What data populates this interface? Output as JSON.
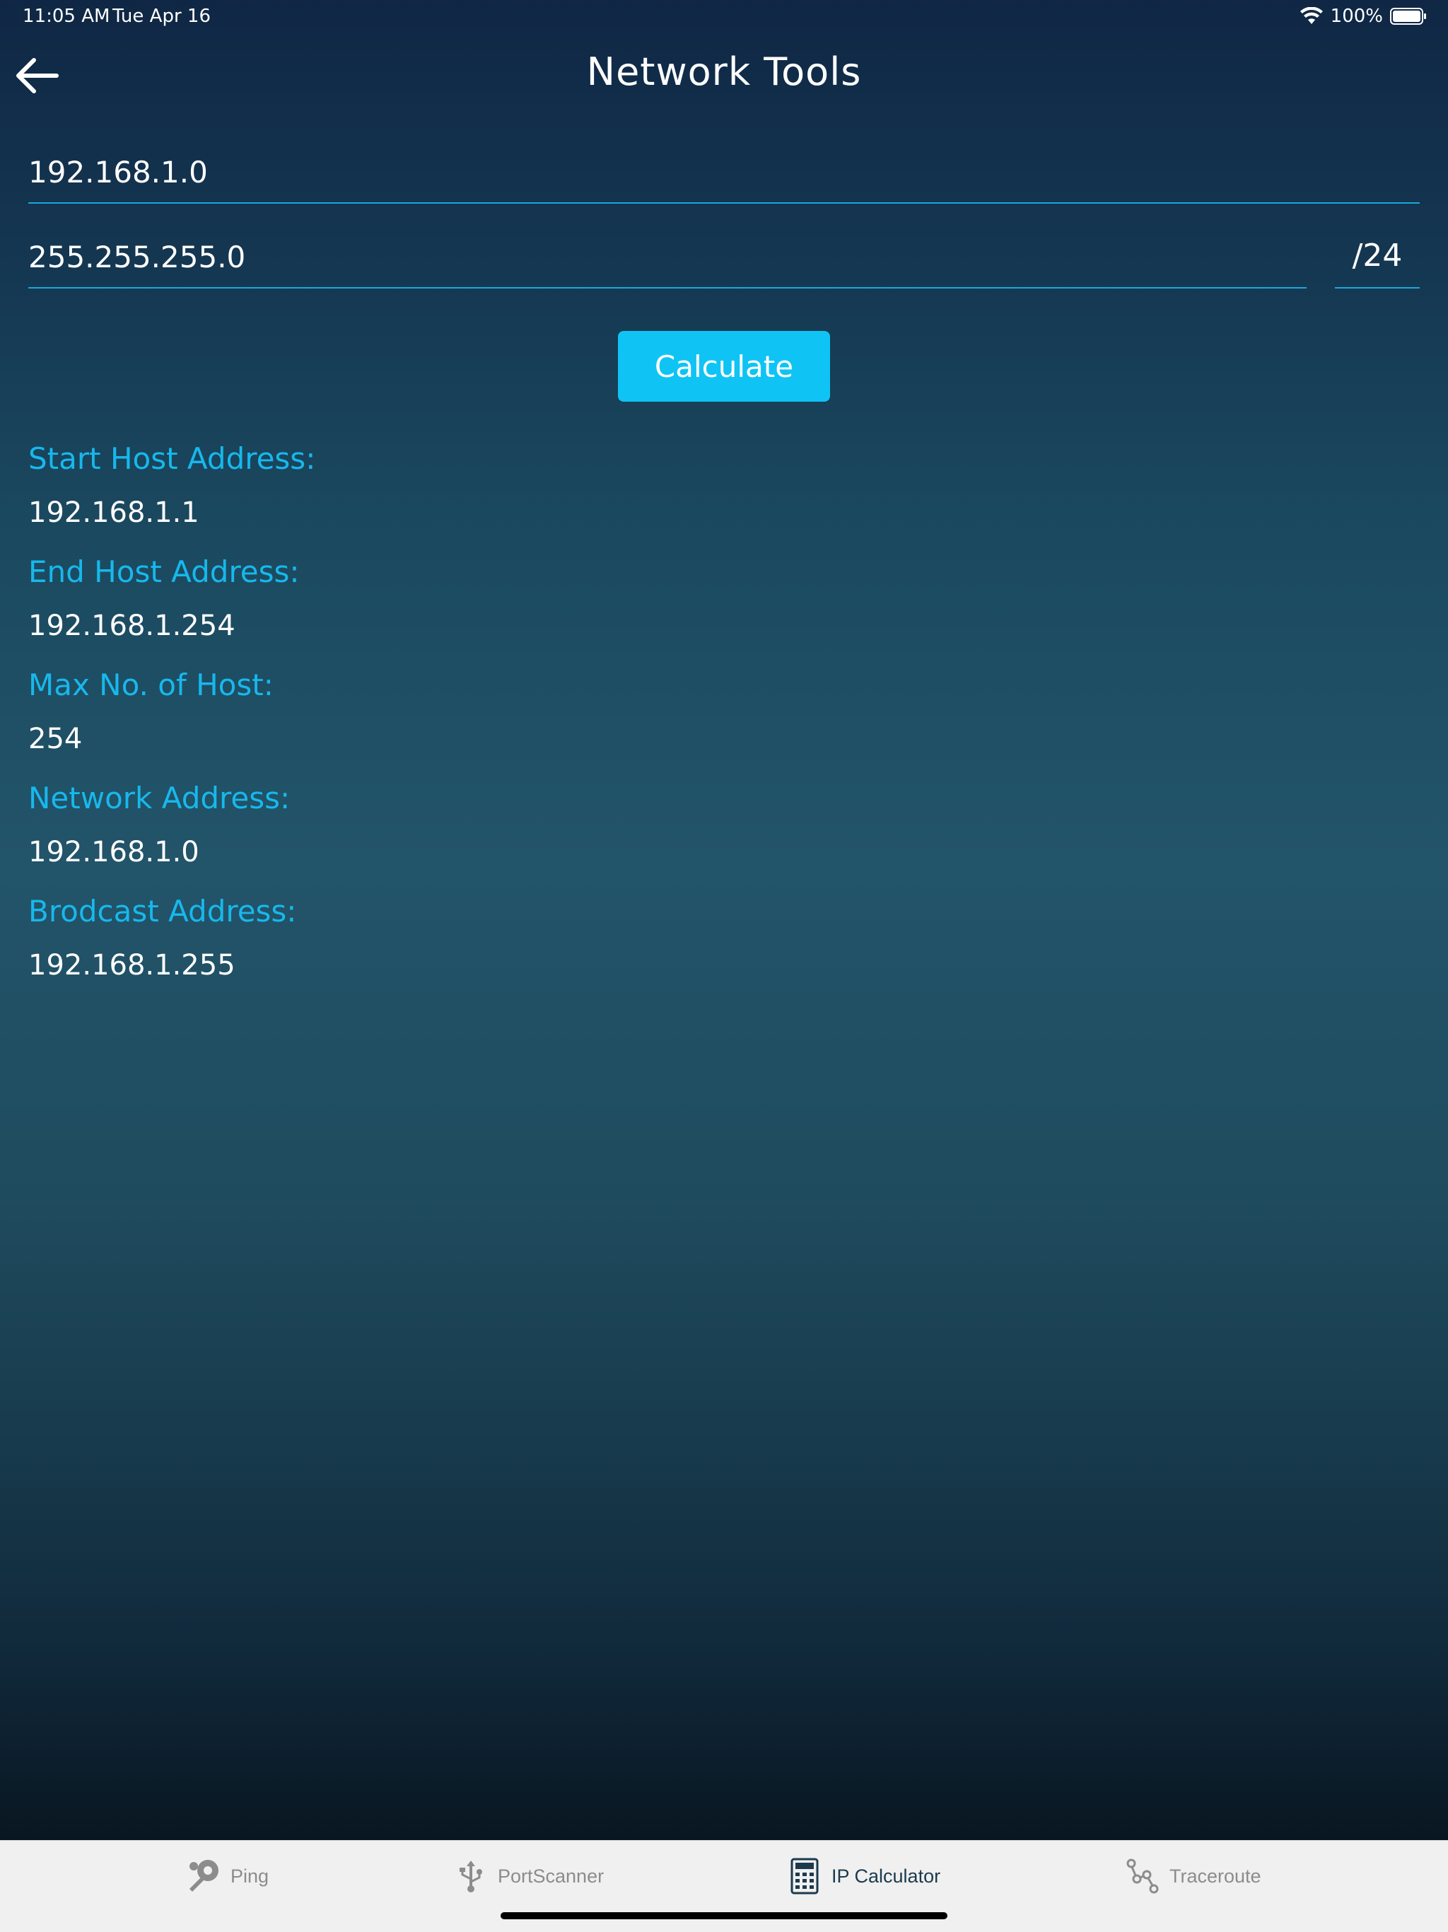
{
  "status_bar": {
    "time": "11:05 AM",
    "date": "Tue Apr 16",
    "battery": "100%"
  },
  "header": {
    "title": "Network Tools"
  },
  "form": {
    "ip_value": "192.168.1.0",
    "mask_value": "255.255.255.0",
    "cidr": "/24",
    "calculate_label": "Calculate"
  },
  "results": [
    {
      "label": "Start Host Address:",
      "value": "192.168.1.1"
    },
    {
      "label": "End Host Address:",
      "value": "192.168.1.254"
    },
    {
      "label": "Max No. of Host:",
      "value": "254"
    },
    {
      "label": "Network Address:",
      "value": "192.168.1.0"
    },
    {
      "label": "Brodcast Address:",
      "value": "192.168.1.255"
    }
  ],
  "tabs": [
    {
      "label": "Ping",
      "icon": "ping-pong-icon"
    },
    {
      "label": "PortScanner",
      "icon": "usb-icon"
    },
    {
      "label": "IP Calculator",
      "icon": "calculator-icon",
      "active": true
    },
    {
      "label": "Traceroute",
      "icon": "route-icon"
    }
  ],
  "colors": {
    "accent": "#17b8ec",
    "button": "#0fc4f5",
    "active_tab": "#1c3a4e",
    "inactive_tab": "#8c8c8c"
  }
}
